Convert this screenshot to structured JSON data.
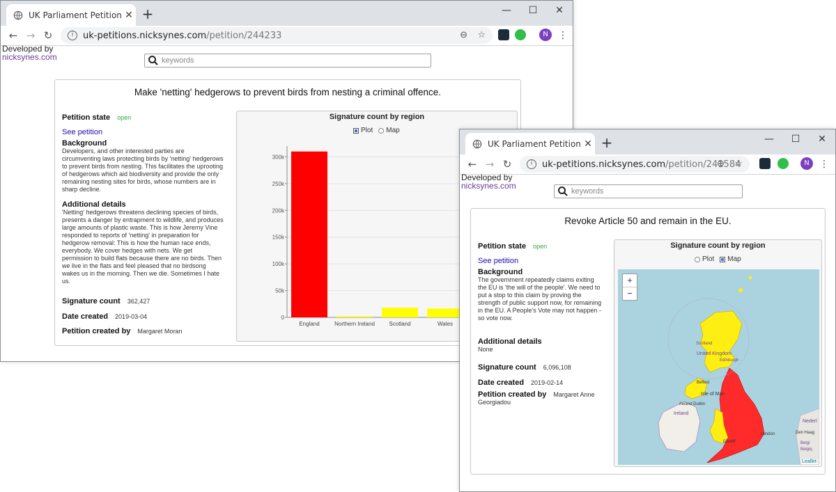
{
  "window1": {
    "tab_title": "UK Parliament Petitions (React Ap",
    "url_host": "uk-petitions.nicksynes.com",
    "url_path": "/petition/244233",
    "profile_initial": "N",
    "developed_by": "Developed by",
    "developer_link": "nicksynes.com",
    "search_placeholder": "keywords",
    "petition": {
      "title": "Make 'netting' hedgerows to prevent birds from nesting a criminal offence.",
      "state_label": "Petition state",
      "state_value": "open",
      "see_petition": "See petition",
      "background_label": "Background",
      "background_text": "Developers, and other interested parties are circumventing laws protecting birds by 'netting' hedgerows to prevent birds from nesting.   This facilitates the uprooting of hedgerows which aid biodiversity and provide the only remaining nesting sites for birds, whose numbers are in sharp decline.",
      "details_label": "Additional details",
      "details_text": "'Netting' hedgerows threatens declining species of birds, presents a danger by entrapment to wildlife, and produces large amounts of plastic waste.  This is how Jeremy Vine responded to reports of 'netting' in preparation for hedgerow removal:  This is how the human race ends, everybody.  We cover hedges with nets. We get permission to build flats because there are no birds. Then we live in the flats and feel pleased that no birdsong wakes us in the morning. Then we die.  Sometimes I hate us.",
      "sigcount_label": "Signature count",
      "sigcount_value": "362,427",
      "date_label": "Date created",
      "date_value": "2019-03-04",
      "creator_label": "Petition created by",
      "creator_value": "Margaret Moran"
    },
    "chart": {
      "title": "Signature count by region",
      "plot_label": "Plot",
      "map_label": "Map",
      "selected": "Plot"
    }
  },
  "window2": {
    "tab_title": "UK Parliament Petitions (React Ap",
    "url_host": "uk-petitions.nicksynes.com",
    "url_path": "/petition/241584",
    "profile_initial": "N",
    "developed_by": "Developed by",
    "developer_link": "nicksynes.com",
    "search_placeholder": "keywords",
    "petition": {
      "title": "Revoke Article 50 and remain in the EU.",
      "state_label": "Petition state",
      "state_value": "open",
      "see_petition": "See petition",
      "background_label": "Background",
      "background_text": "The government repeatedly claims exiting the EU is 'the will of the people'. We need to put a stop to this claim by proving the strength of public support now, for remaining in the EU. A People's Vote may not happen - so vote now.",
      "details_label": "Additional details",
      "details_text": "None",
      "sigcount_label": "Signature count",
      "sigcount_value": "6,096,108",
      "date_label": "Date created",
      "date_value": "2019-02-14",
      "creator_label": "Petition created by",
      "creator_value_line1": "Margaret Anne",
      "creator_value_line2": "Georgiadou"
    },
    "chart": {
      "title": "Signature count by region",
      "plot_label": "Plot",
      "map_label": "Map",
      "selected": "Map"
    },
    "map": {
      "zoom_in": "+",
      "zoom_out": "−",
      "attribution": "Leaflet",
      "labels": [
        "Scotland",
        "United Kingdom",
        "Edinburgh",
        "Belfast",
        "Isle of Man",
        "Ireland",
        "Dublin",
        "Ireland",
        "Cardiff",
        "London",
        "Nederl",
        "Den Haag",
        "Belgi",
        "Belgiq"
      ],
      "england_color": "#ff2b2b",
      "other_color": "#ffee11"
    }
  },
  "chart_data": {
    "type": "bar",
    "title": "Signature count by region",
    "categories": [
      "England",
      "Northern Ireland",
      "Scotland",
      "Wales"
    ],
    "values": [
      310000,
      2000,
      18000,
      16500
    ],
    "colors": [
      "#ff0000",
      "#ffff00",
      "#ffff00",
      "#ffff00"
    ],
    "ylim": [
      0,
      320000
    ],
    "yticks": [
      0,
      50000,
      100000,
      150000,
      200000,
      250000,
      300000
    ],
    "ytick_labels": [
      "0",
      "50k",
      "100k",
      "150k",
      "200k",
      "250k",
      "300k"
    ],
    "grid": true
  }
}
